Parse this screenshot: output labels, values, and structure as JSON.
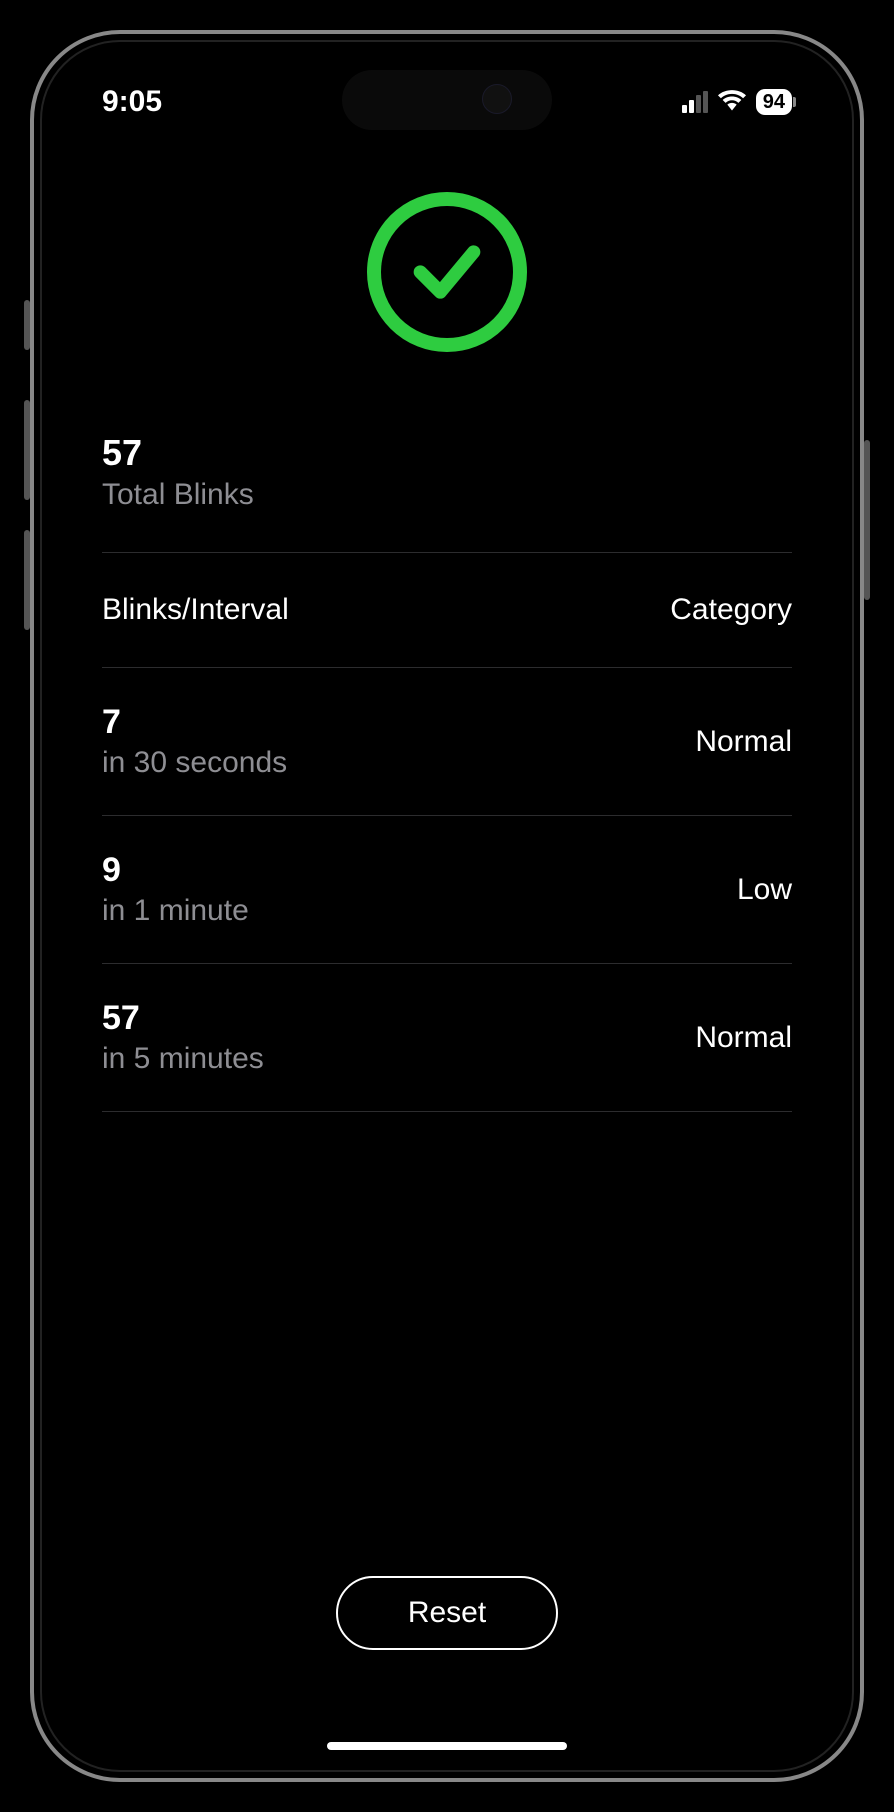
{
  "status_bar": {
    "time": "9:05",
    "battery_percent": "94"
  },
  "result": {
    "total_blinks_value": "57",
    "total_blinks_label": "Total Blinks"
  },
  "table": {
    "header_left": "Blinks/Interval",
    "header_right": "Category",
    "rows": [
      {
        "value": "7",
        "interval": "in 30 seconds",
        "category": "Normal"
      },
      {
        "value": "9",
        "interval": "in 1 minute",
        "category": "Low"
      },
      {
        "value": "57",
        "interval": "in 5 minutes",
        "category": "Normal"
      }
    ]
  },
  "buttons": {
    "reset": "Reset"
  },
  "colors": {
    "accent_green": "#2ECC40",
    "text_primary": "#FFFFFF",
    "text_secondary": "#8e8e93",
    "divider": "#2c2c2e"
  }
}
